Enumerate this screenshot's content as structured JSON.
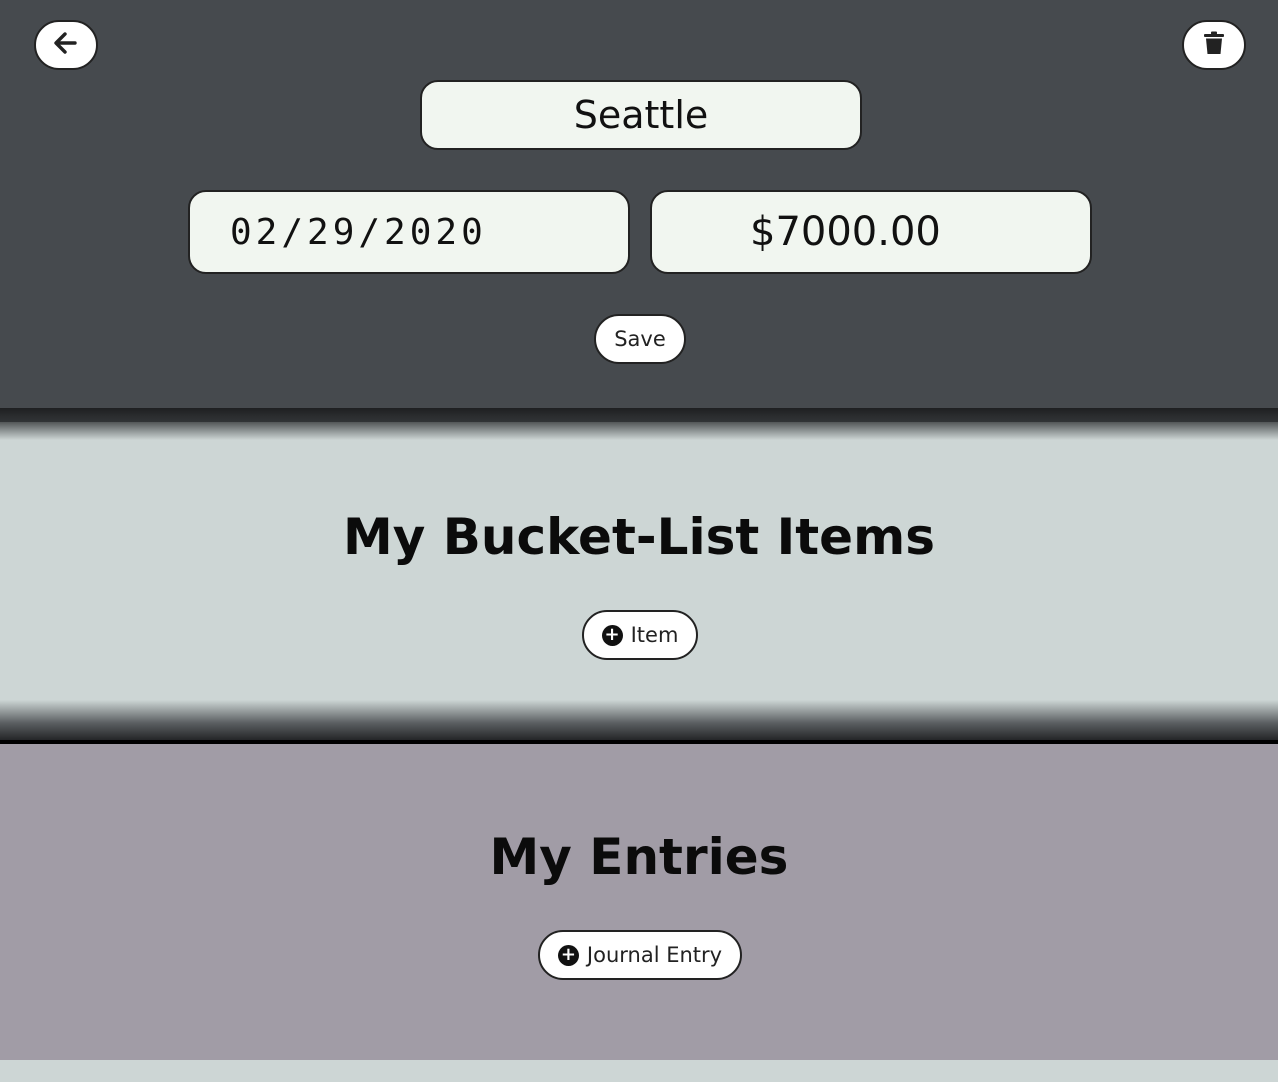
{
  "header": {
    "back_icon": "arrow-left-icon",
    "delete_icon": "trash-icon",
    "trip_name": "Seattle",
    "trip_date": "02/29/2020",
    "trip_cost": "$7000.00",
    "save_label": "Save"
  },
  "bucket_list": {
    "title": "My Bucket-List Items",
    "add_label": "Item",
    "add_icon": "plus-circle-icon"
  },
  "entries": {
    "title": "My Entries",
    "add_label": "Journal Entry",
    "add_icon": "plus-circle-icon"
  },
  "colors": {
    "header_bg": "#464a4e",
    "bucket_bg": "#cdd6d5",
    "entries_bg": "#a19ca6",
    "field_bg": "#f1f6f0"
  }
}
